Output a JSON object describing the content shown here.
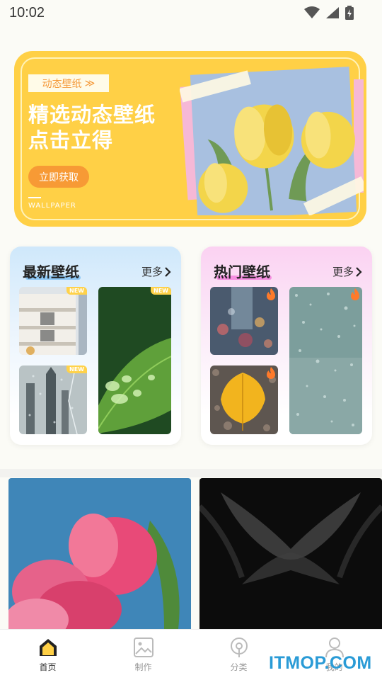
{
  "status_bar": {
    "time": "10:02"
  },
  "banner": {
    "tag": "动态壁纸",
    "tag_arrow": "≫",
    "title_line1": "精选动态壁纸",
    "title_line2": "点击立得",
    "button": "立即获取",
    "caption": "WALLPAPER"
  },
  "sections": {
    "new": {
      "title": "最新壁纸",
      "more": "更多",
      "badge": "NEW"
    },
    "hot": {
      "title": "热门壁纸",
      "more": "更多"
    }
  },
  "bottom_nav": {
    "items": [
      {
        "label": "首页"
      },
      {
        "label": "制作"
      },
      {
        "label": "分类"
      },
      {
        "label": "我的"
      }
    ]
  },
  "watermark": "ITMOP.COM",
  "colors": {
    "accent": "#ffd046",
    "button": "#f79a35",
    "new_highlight": "#8ec8f5",
    "hot_highlight": "#f58ee0"
  }
}
